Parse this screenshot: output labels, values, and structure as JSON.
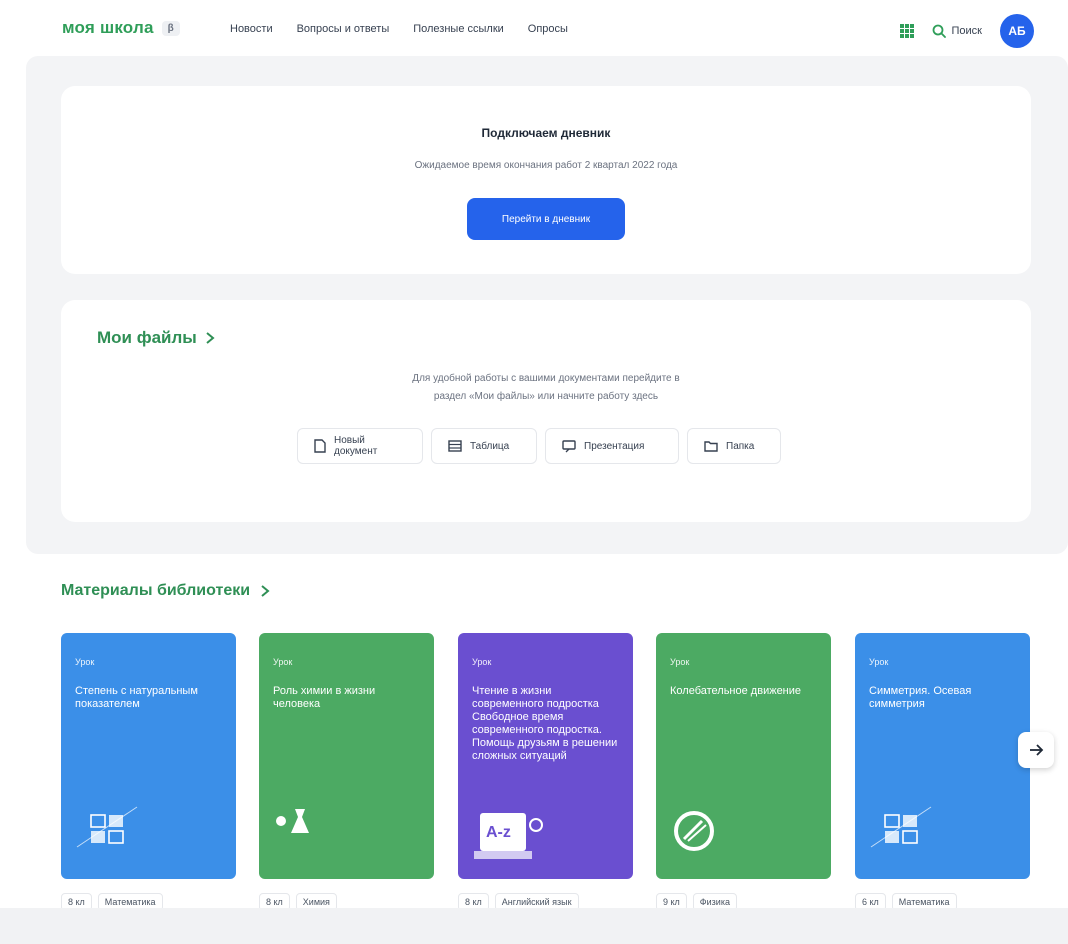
{
  "header": {
    "logo": "моя школа",
    "beta": "β",
    "nav": [
      "Новости",
      "Вопросы и ответы",
      "Полезные ссылки",
      "Опросы"
    ],
    "search_label": "Поиск",
    "avatar_initials": "АБ",
    "brand_color": "#2f9e59"
  },
  "diary": {
    "title": "Подключаем дневник",
    "subtitle": "Ожидаемое время окончания работ 2 квартал 2022 года",
    "button": "Перейти в дневник"
  },
  "files": {
    "title": "Мои файлы",
    "desc_line1": "Для удобной работы с вашими документами перейдите в",
    "desc_line2": "раздел «Мои файлы» или начните работу здесь",
    "actions": [
      "Новый документ",
      "Таблица",
      "Презентация",
      "Папка"
    ]
  },
  "library": {
    "title": "Материалы библиотеки",
    "cards": [
      {
        "kind": "Урок",
        "name": "Степень с натуральным показателем",
        "color": "#3b8fe8",
        "grade": "8 кл",
        "subject": "Математика",
        "icon": "math-icon"
      },
      {
        "kind": "Урок",
        "name": "Роль химии в жизни человека",
        "color": "#4caa63",
        "grade": "8 кл",
        "subject": "Химия",
        "icon": "flask-icon"
      },
      {
        "kind": "Урок",
        "name": "Чтение в жизни современного подростка Свободное время современного подростка. Помощь друзьям в решении сложных ситуаций",
        "color": "#6a4fd0",
        "grade": "8 кл",
        "subject": "Английский язык",
        "icon": "dictionary-icon"
      },
      {
        "kind": "Урок",
        "name": "Колебательное движение",
        "color": "#4caa63",
        "grade": "9 кл",
        "subject": "Физика",
        "icon": "pendulum-icon"
      },
      {
        "kind": "Урок",
        "name": "Симметрия. Осевая симметрия",
        "color": "#3b8fe8",
        "grade": "6 кл",
        "subject": "Математика",
        "icon": "math-icon"
      }
    ]
  }
}
